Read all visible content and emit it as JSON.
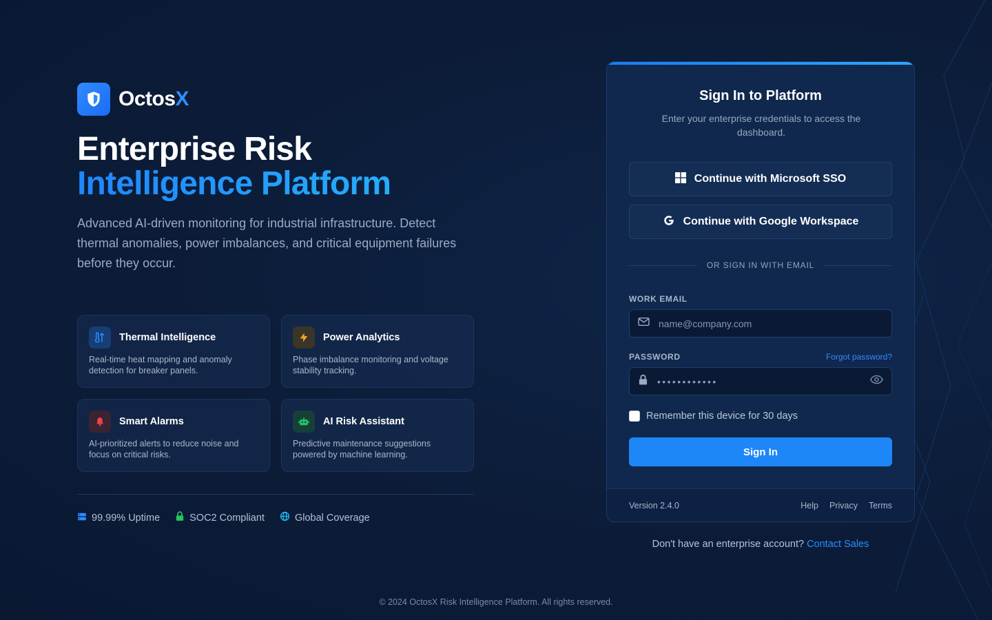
{
  "brand": {
    "name_main": "Octos",
    "name_accent": "X"
  },
  "hero": {
    "headline_line1": "Enterprise Risk",
    "headline_line2": "Intelligence Platform",
    "lede": "Advanced AI-driven monitoring for industrial infrastructure. Detect thermal anomalies, power imbalances, and critical equipment failures before they occur."
  },
  "features": [
    {
      "title": "Thermal Intelligence",
      "desc": "Real-time heat mapping and anomaly detection for breaker panels.",
      "icon": "thermometer-icon",
      "color": "#2d8cff"
    },
    {
      "title": "Power Analytics",
      "desc": "Phase imbalance monitoring and voltage stability tracking.",
      "icon": "bolt-icon",
      "color": "#f5a524"
    },
    {
      "title": "Smart Alarms",
      "desc": "AI-prioritized alerts to reduce noise and focus on critical risks.",
      "icon": "bell-icon",
      "color": "#ef4444"
    },
    {
      "title": "AI Risk Assistant",
      "desc": "Predictive maintenance suggestions powered by machine learning.",
      "icon": "robot-icon",
      "color": "#22c55e"
    }
  ],
  "stats": [
    {
      "label": "99.99% Uptime",
      "icon": "server-icon",
      "color": "#2d8cff"
    },
    {
      "label": "SOC2 Compliant",
      "icon": "lock-icon",
      "color": "#22c55e"
    },
    {
      "label": "Global Coverage",
      "icon": "globe-icon",
      "color": "#22b8f0"
    }
  ],
  "login": {
    "title": "Sign In to Platform",
    "subtitle": "Enter your enterprise credentials to access the dashboard.",
    "microsoft_sso": "Continue with Microsoft SSO",
    "google_sso": "Continue with Google Workspace",
    "divider": "OR SIGN IN WITH EMAIL",
    "email_label": "WORK EMAIL",
    "email_placeholder": "name@company.com",
    "password_label": "PASSWORD",
    "forgot": "Forgot password?",
    "password_mask": "••••••••••••",
    "remember": "Remember this device for 30 days",
    "submit": "Sign In",
    "version": "Version 2.4.0",
    "links": [
      "Help",
      "Privacy",
      "Terms"
    ]
  },
  "signup": {
    "prompt": "Don't have an enterprise account?",
    "cta": "Contact Sales"
  },
  "footer": {
    "copyright": "© 2024 OctosX Risk Intelligence Platform. All rights reserved."
  },
  "colors": {
    "accent": "#1e87f8",
    "background": "#0c1c38",
    "card": "#10284d"
  }
}
